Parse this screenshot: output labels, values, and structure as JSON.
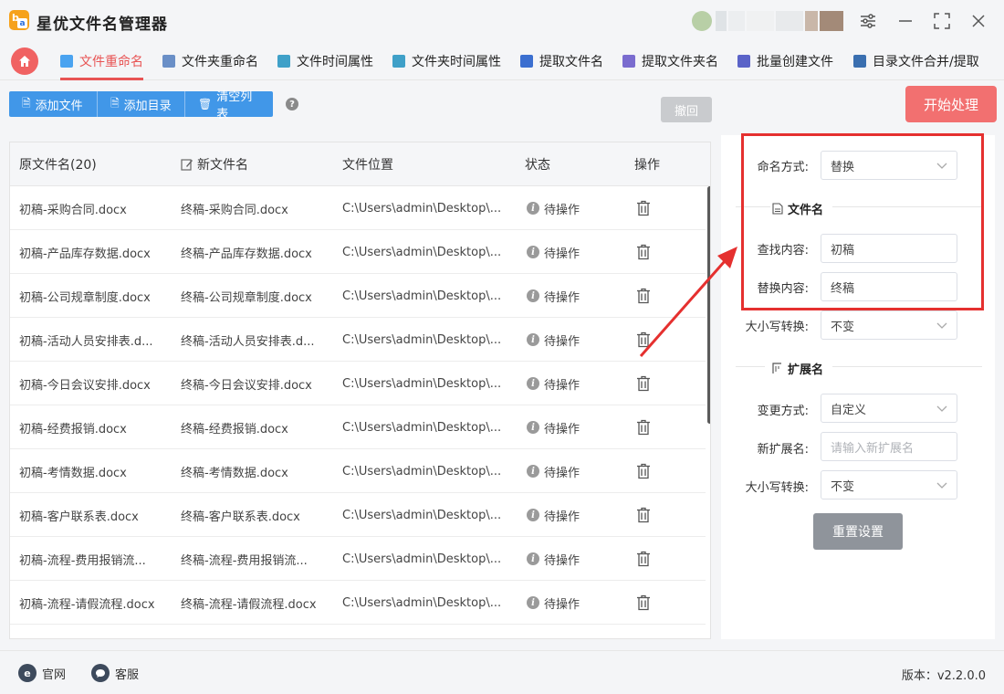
{
  "app": {
    "title": "星优文件名管理器",
    "logo_b": "b",
    "logo_a": "a"
  },
  "nav": {
    "tabs": [
      {
        "label": "文件重命名",
        "icon": "rename-file-icon",
        "color": "#4aa3f0"
      },
      {
        "label": "文件夹重命名",
        "icon": "rename-folder-icon",
        "color": "#6a8fc7"
      },
      {
        "label": "文件时间属性",
        "icon": "file-time-icon",
        "color": "#3fa0c8"
      },
      {
        "label": "文件夹时间属性",
        "icon": "folder-time-icon",
        "color": "#3fa0c8"
      },
      {
        "label": "提取文件名",
        "icon": "extract-filename-icon",
        "color": "#3b6fd0"
      },
      {
        "label": "提取文件夹名",
        "icon": "extract-foldername-icon",
        "color": "#7a6ccf"
      },
      {
        "label": "批量创建文件",
        "icon": "batch-create-icon",
        "color": "#5a63c8"
      },
      {
        "label": "目录文件合并/提取",
        "icon": "merge-extract-icon",
        "color": "#3a6fb0"
      }
    ]
  },
  "toolbar": {
    "add_file": "添加文件",
    "add_folder": "添加目录",
    "clear_list": "清空列表",
    "undo": "撤回",
    "start": "开始处理",
    "help": "?"
  },
  "table": {
    "headers": {
      "original": "原文件名(20)",
      "new": "新文件名",
      "location": "文件位置",
      "status": "状态",
      "action": "操作"
    },
    "rows": [
      {
        "original": "初稿-采购合同.docx",
        "new": "终稿-采购合同.docx",
        "location": "C:\\Users\\admin\\Desktop\\...",
        "status": "待操作"
      },
      {
        "original": "初稿-产品库存数据.docx",
        "new": "终稿-产品库存数据.docx",
        "location": "C:\\Users\\admin\\Desktop\\...",
        "status": "待操作"
      },
      {
        "original": "初稿-公司规章制度.docx",
        "new": "终稿-公司规章制度.docx",
        "location": "C:\\Users\\admin\\Desktop\\...",
        "status": "待操作"
      },
      {
        "original": "初稿-活动人员安排表.d...",
        "new": "终稿-活动人员安排表.d...",
        "location": "C:\\Users\\admin\\Desktop\\...",
        "status": "待操作"
      },
      {
        "original": "初稿-今日会议安排.docx",
        "new": "终稿-今日会议安排.docx",
        "location": "C:\\Users\\admin\\Desktop\\...",
        "status": "待操作"
      },
      {
        "original": "初稿-经费报销.docx",
        "new": "终稿-经费报销.docx",
        "location": "C:\\Users\\admin\\Desktop\\...",
        "status": "待操作"
      },
      {
        "original": "初稿-考情数据.docx",
        "new": "终稿-考情数据.docx",
        "location": "C:\\Users\\admin\\Desktop\\...",
        "status": "待操作"
      },
      {
        "original": "初稿-客户联系表.docx",
        "new": "终稿-客户联系表.docx",
        "location": "C:\\Users\\admin\\Desktop\\...",
        "status": "待操作"
      },
      {
        "original": "初稿-流程-费用报销流...",
        "new": "终稿-流程-费用报销流...",
        "location": "C:\\Users\\admin\\Desktop\\...",
        "status": "待操作"
      },
      {
        "original": "初稿-流程-请假流程.docx",
        "new": "终稿-流程-请假流程.docx",
        "location": "C:\\Users\\admin\\Desktop\\...",
        "status": "待操作"
      }
    ]
  },
  "settings": {
    "naming_mode_label": "命名方式:",
    "naming_mode_value": "替换",
    "filename_section": "文件名",
    "find_label": "查找内容:",
    "find_value": "初稿",
    "replace_label": "替换内容:",
    "replace_value": "终稿",
    "case1_label": "大小写转换:",
    "case1_value": "不变",
    "ext_section": "扩展名",
    "change_mode_label": "变更方式:",
    "change_mode_value": "自定义",
    "new_ext_label": "新扩展名:",
    "new_ext_placeholder": "请输入新扩展名",
    "case2_label": "大小写转换:",
    "case2_value": "不变",
    "reset": "重置设置"
  },
  "footer": {
    "website": "官网",
    "support": "客服",
    "version": "版本：v2.2.0.0",
    "website_icon": "e"
  },
  "colors": {
    "accent": "#e85454",
    "primary": "#4197e8",
    "start": "#f27070",
    "highlight": "#e5302f"
  }
}
